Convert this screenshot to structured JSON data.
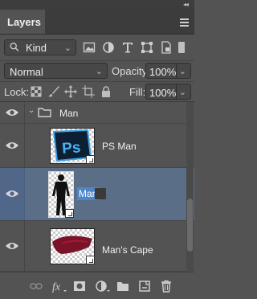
{
  "panel": {
    "tab_label": "Layers"
  },
  "filter": {
    "kind_label": "Kind"
  },
  "blend": {
    "mode": "Normal",
    "opacity_label": "Opacity:",
    "opacity_value": "100%"
  },
  "lock": {
    "label": "Lock:",
    "fill_label": "Fill:",
    "fill_value": "100%"
  },
  "layers": [
    {
      "name": "Man",
      "type": "group",
      "visible": true
    },
    {
      "name": "PS Man",
      "type": "smart-object",
      "visible": true
    },
    {
      "name": "Man",
      "type": "smart-object",
      "visible": true,
      "selected": true,
      "editing": true
    },
    {
      "name": "Man's Cape",
      "type": "smart-object",
      "visible": true
    }
  ],
  "colors": {
    "panel_bg": "#535353",
    "selection": "#5a6e88",
    "name_highlight": "#4d86c9"
  }
}
